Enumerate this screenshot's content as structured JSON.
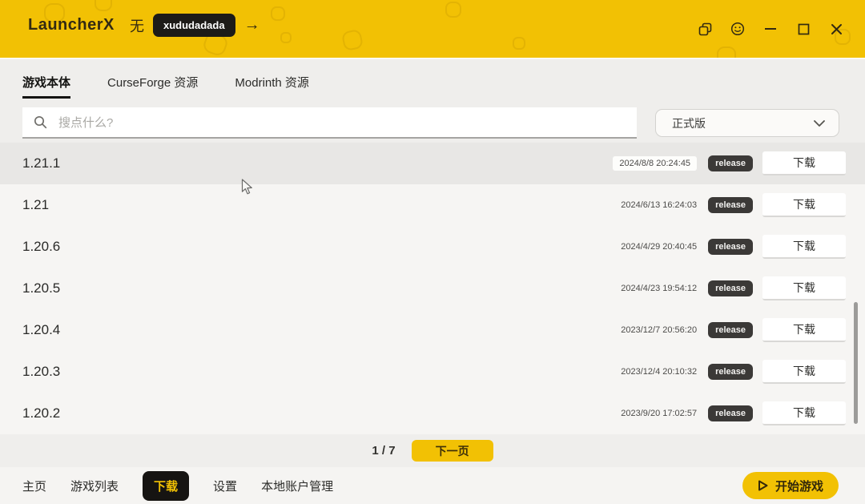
{
  "colors": {
    "accent": "#f2c104",
    "header-bg": "#f2c104",
    "titlebar-text": "#332a12",
    "account-pill-bg": "#1d1b18",
    "badge-bg": "#3b3937",
    "nav-active-bg": "#161412",
    "nav-active-text": "#f2c104",
    "content-bg": "#efeeec",
    "list-bg": "#f6f5f3",
    "row-hover-bg": "#e8e7e5"
  },
  "header": {
    "app_name": "LauncherX",
    "account_prefix": "无",
    "account_name": "xududadada",
    "arrow_glyph": "→"
  },
  "tabs": [
    {
      "label": "游戏本体",
      "state": "active"
    },
    {
      "label": "CurseForge 资源"
    },
    {
      "label": "Modrinth 资源"
    }
  ],
  "search": {
    "placeholder": "搜点什么?"
  },
  "filter": {
    "selected": "正式版"
  },
  "versions": [
    {
      "name": "1.21.1",
      "date": "2024/8/8 20:24:45",
      "badge": "release",
      "action": "下载",
      "state": "hovered"
    },
    {
      "name": "1.21",
      "date": "2024/6/13 16:24:03",
      "badge": "release",
      "action": "下载"
    },
    {
      "name": "1.20.6",
      "date": "2024/4/29 20:40:45",
      "badge": "release",
      "action": "下载"
    },
    {
      "name": "1.20.5",
      "date": "2024/4/23 19:54:12",
      "badge": "release",
      "action": "下载"
    },
    {
      "name": "1.20.4",
      "date": "2023/12/7 20:56:20",
      "badge": "release",
      "action": "下载"
    },
    {
      "name": "1.20.3",
      "date": "2023/12/4 20:10:32",
      "badge": "release",
      "action": "下载"
    },
    {
      "name": "1.20.2",
      "date": "2023/9/20 17:02:57",
      "badge": "release",
      "action": "下载"
    }
  ],
  "pagination": {
    "page_indicator": "1 / 7",
    "next_label": "下一页"
  },
  "bottom_nav": {
    "items": [
      {
        "label": "主页"
      },
      {
        "label": "游戏列表"
      },
      {
        "label": "下载",
        "state": "active"
      },
      {
        "label": "设置"
      },
      {
        "label": "本地账户管理"
      }
    ],
    "start_label": "开始游戏"
  }
}
